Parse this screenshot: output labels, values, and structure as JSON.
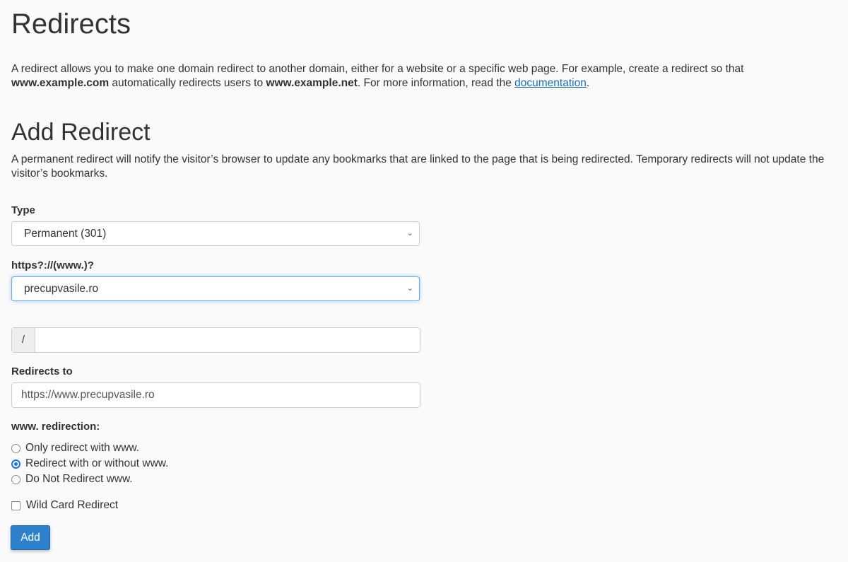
{
  "page_title": "Redirects",
  "intro": {
    "part1": "A redirect allows you to make one domain redirect to another domain, either for a website or a specific web page. For example, create a redirect so that ",
    "bold1": "www.example.com",
    "part2": " automatically redirects users to ",
    "bold2": "www.example.net",
    "part3": ". For more information, read the ",
    "link": "documentation",
    "part4": "."
  },
  "add_redirect": {
    "title": "Add Redirect",
    "description": "A permanent redirect will notify the visitor’s browser to update any bookmarks that are linked to the page that is being redirected. Temporary redirects will not update the visitor’s bookmarks.",
    "type_label": "Type",
    "type_value": "Permanent (301)",
    "domain_label": "https?://(www.)?",
    "domain_value": "precupvasile.ro",
    "path_prefix": "/",
    "path_value": "",
    "redirects_to_label": "Redirects to",
    "redirects_to_value": "https://www.precupvasile.ro",
    "www_label": "www. redirection:",
    "www_options": [
      {
        "label": "Only redirect with www.",
        "checked": false
      },
      {
        "label": "Redirect with or without www.",
        "checked": true
      },
      {
        "label": "Do Not Redirect www.",
        "checked": false
      }
    ],
    "wildcard_label": "Wild Card Redirect",
    "wildcard_checked": false,
    "add_button": "Add"
  },
  "colors": {
    "accent": "#2d80cc",
    "link": "#1b6fb7",
    "radio": "#1a73e8"
  }
}
